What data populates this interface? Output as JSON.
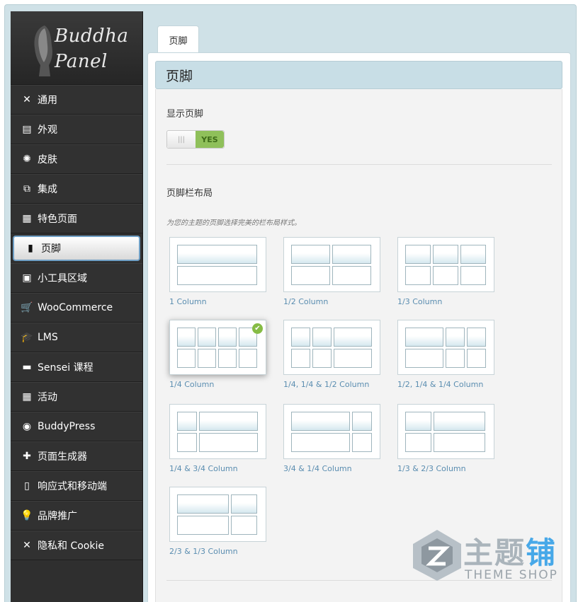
{
  "logo": {
    "line1": "Buddha",
    "line2": "Panel"
  },
  "sidebar": {
    "items": [
      {
        "label": "通用",
        "icon": "wrench-icon",
        "glyph": "✕"
      },
      {
        "label": "外观",
        "icon": "layout-icon",
        "glyph": "▤"
      },
      {
        "label": "皮肤",
        "icon": "wheel-icon",
        "glyph": "✺"
      },
      {
        "label": "集成",
        "icon": "window-icon",
        "glyph": "⧉"
      },
      {
        "label": "特色页面",
        "icon": "grid-icon",
        "glyph": "▦"
      },
      {
        "label": "页脚",
        "icon": "phone-icon",
        "glyph": "▮"
      },
      {
        "label": "小工具区域",
        "icon": "widget-icon",
        "glyph": "▣"
      },
      {
        "label": "WooCommerce",
        "icon": "cart-icon",
        "glyph": "🛒"
      },
      {
        "label": "LMS",
        "icon": "graduation-cap-icon",
        "glyph": "🎓"
      },
      {
        "label": "Sensei 课程",
        "icon": "book-icon",
        "glyph": "▬"
      },
      {
        "label": "活动",
        "icon": "calendar-icon",
        "glyph": "▦"
      },
      {
        "label": "BuddyPress",
        "icon": "user-circle-icon",
        "glyph": "◉"
      },
      {
        "label": "页面生成器",
        "icon": "page-add-icon",
        "glyph": "✚"
      },
      {
        "label": "响应式和移动端",
        "icon": "tablet-icon",
        "glyph": "▯"
      },
      {
        "label": "品牌推广",
        "icon": "bulb-icon",
        "glyph": "💡"
      },
      {
        "label": "隐私和 Cookie",
        "icon": "tools-icon",
        "glyph": "✕"
      }
    ],
    "active_index": 5
  },
  "tab": {
    "label": "页脚"
  },
  "panel": {
    "title": "页脚"
  },
  "show_footer": {
    "label": "显示页脚",
    "toggle_off": "|||",
    "toggle_on": "YES",
    "value": true
  },
  "layout": {
    "label": "页脚栏布局",
    "description": "为您的主题的页脚选择完美的栏布局样式。",
    "options": [
      {
        "caption": "1 Column",
        "selected": false
      },
      {
        "caption": "1/2 Column",
        "selected": false
      },
      {
        "caption": "1/3 Column",
        "selected": false
      },
      {
        "caption": "1/4 Column",
        "selected": true
      },
      {
        "caption": "1/4, 1/4 & 1/2 Column",
        "selected": false
      },
      {
        "caption": "1/2, 1/4 & 1/4 Column",
        "selected": false
      },
      {
        "caption": "1/4 & 3/4 Column",
        "selected": false
      },
      {
        "caption": "3/4 & 1/4 Column",
        "selected": false
      },
      {
        "caption": "1/3 & 2/3 Column",
        "selected": false
      },
      {
        "caption": "2/3 & 1/3 Column",
        "selected": false
      }
    ]
  },
  "watermark": {
    "main_gray": "主题",
    "main_blue": "铺",
    "sub": "THEME SHOP"
  },
  "colors": {
    "accent_green": "#86bc45",
    "header_blue": "#c8dee6",
    "sidebar_dark": "#2f2f2f"
  }
}
